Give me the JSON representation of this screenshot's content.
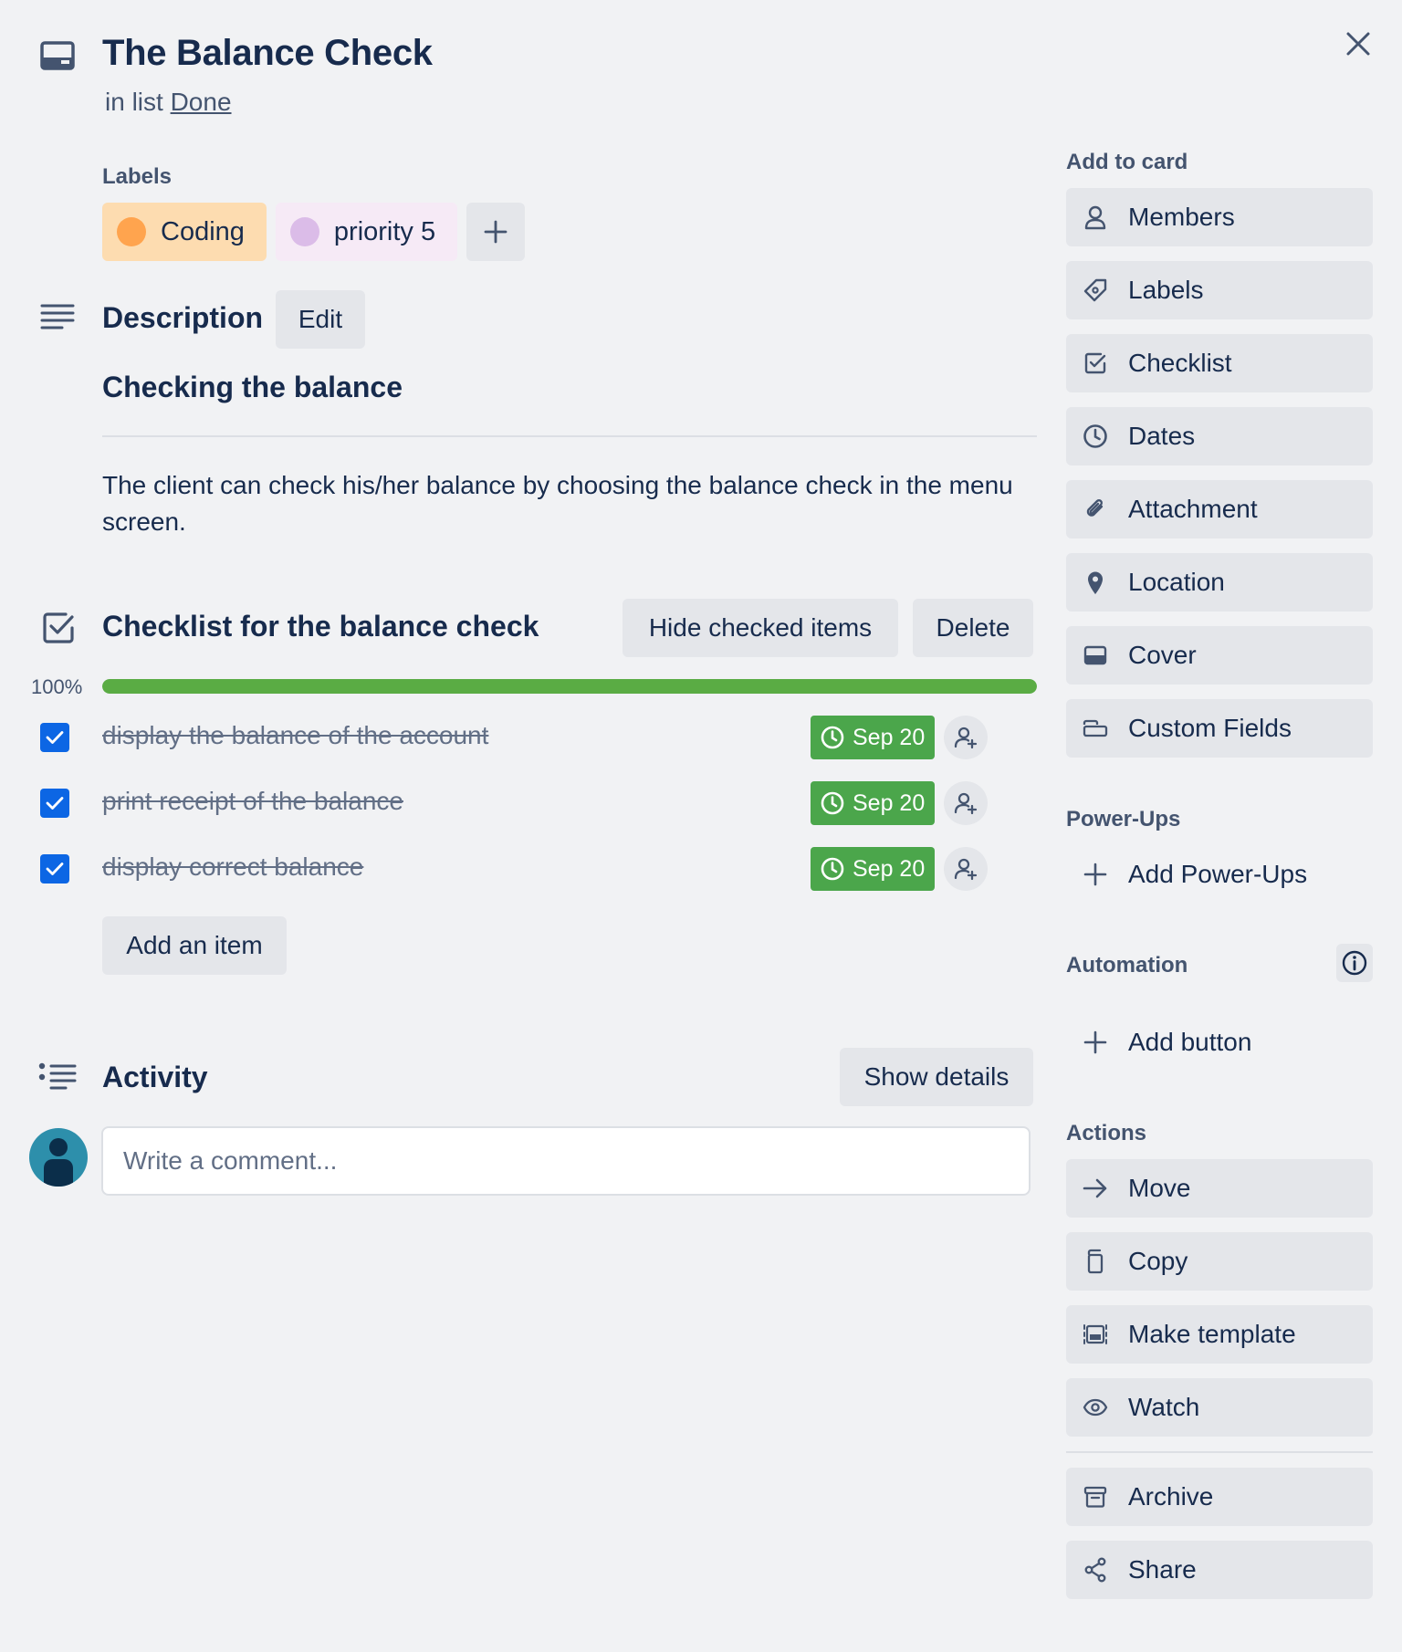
{
  "card": {
    "title": "The Balance Check",
    "list_prefix": "in list",
    "list_name": "Done"
  },
  "labels": {
    "heading": "Labels",
    "items": [
      {
        "text": "Coding",
        "bg": "#fddcb0",
        "dot": "#ffa44e"
      },
      {
        "text": "priority 5",
        "bg": "#f6eaf6",
        "dot": "#dbbce8"
      }
    ]
  },
  "description": {
    "heading": "Description",
    "edit_label": "Edit",
    "subheading": "Checking the balance",
    "body": "The client can check his/her balance by choosing the balance check in the menu screen."
  },
  "checklist": {
    "title": "Checklist for the balance check",
    "hide_label": "Hide checked items",
    "delete_label": "Delete",
    "progress_text": "100%",
    "progress": 1.0,
    "items": [
      {
        "text": "display the balance of the account",
        "due": "Sep 20",
        "checked": true
      },
      {
        "text": "print receipt of the balance",
        "due": "Sep 20",
        "checked": true
      },
      {
        "text": "display correct balance",
        "due": "Sep 20",
        "checked": true
      }
    ],
    "add_item_label": "Add an item"
  },
  "activity": {
    "heading": "Activity",
    "show_details_label": "Show details",
    "comment_placeholder": "Write a comment..."
  },
  "sidebar": {
    "add_to_card": {
      "heading": "Add to card",
      "items": [
        "Members",
        "Labels",
        "Checklist",
        "Dates",
        "Attachment",
        "Location",
        "Cover",
        "Custom Fields"
      ]
    },
    "power_ups": {
      "heading": "Power-Ups",
      "add_label": "Add Power-Ups"
    },
    "automation": {
      "heading": "Automation",
      "add_label": "Add button"
    },
    "actions": {
      "heading": "Actions",
      "items": [
        "Move",
        "Copy",
        "Make template",
        "Watch",
        "Archive",
        "Share"
      ]
    }
  },
  "colors": {
    "accent_blue": "#0c66e4",
    "progress_green": "#5aac44",
    "due_green": "#4ba64b"
  }
}
